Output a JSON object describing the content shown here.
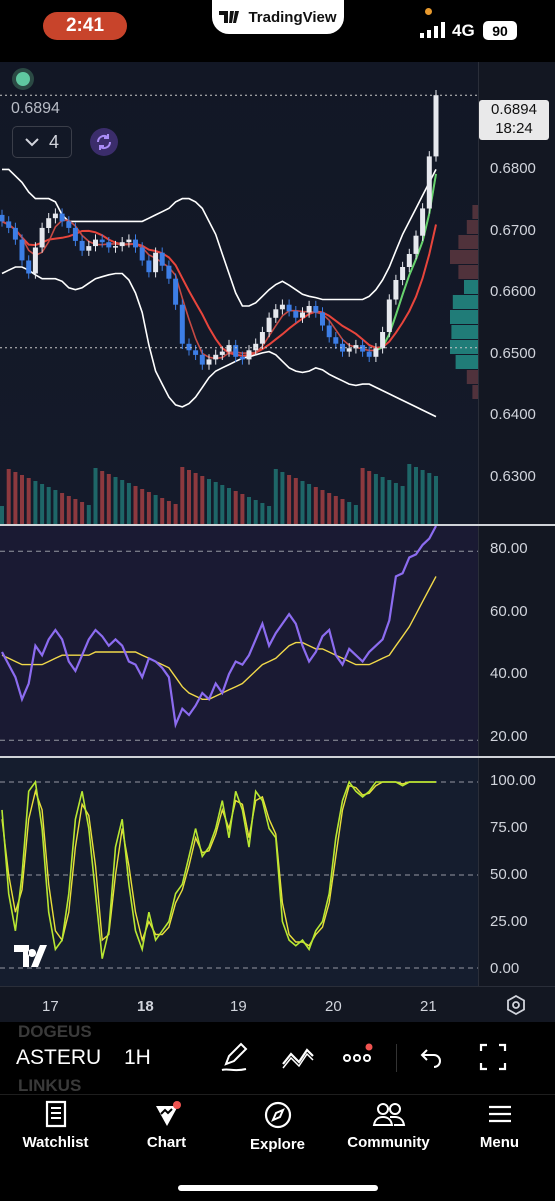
{
  "status_bar": {
    "time": "2:41",
    "app_badge": "TradingView",
    "network": "4G",
    "battery": "90"
  },
  "chart": {
    "last_price_label": "0.6894",
    "price_tag_value": "0.6894",
    "price_tag_countdown": "18:24",
    "collapse_count": "4",
    "price_axis": [
      "0.6800",
      "0.6700",
      "0.6600",
      "0.6500",
      "0.6400",
      "0.6300"
    ],
    "rsi_axis": [
      "80.00",
      "60.00",
      "40.00",
      "20.00"
    ],
    "stoch_axis": [
      "100.00",
      "75.00",
      "50.00",
      "25.00",
      "0.00"
    ],
    "time_axis": [
      "17",
      "18",
      "19",
      "20",
      "21"
    ]
  },
  "chart_data": [
    {
      "type": "candlestick",
      "title": "",
      "ylim": [
        0.6235,
        0.6945
      ],
      "close": [
        0.67,
        0.669,
        0.6672,
        0.664,
        0.662,
        0.666,
        0.669,
        0.6705,
        0.6712,
        0.67,
        0.669,
        0.667,
        0.6655,
        0.6662,
        0.6672,
        0.6668,
        0.666,
        0.6662,
        0.6668,
        0.6672,
        0.666,
        0.664,
        0.6622,
        0.6652,
        0.6632,
        0.6612,
        0.6572,
        0.6512,
        0.6502,
        0.6495,
        0.648,
        0.6488,
        0.6495,
        0.65,
        0.651,
        0.6492,
        0.6488,
        0.6502,
        0.6512,
        0.653,
        0.6552,
        0.6565,
        0.6572,
        0.6562,
        0.6552,
        0.656,
        0.657,
        0.656,
        0.654,
        0.6522,
        0.6512,
        0.65,
        0.6505,
        0.651,
        0.65,
        0.6492,
        0.6505,
        0.653,
        0.658,
        0.661,
        0.663,
        0.665,
        0.6678,
        0.672,
        0.68,
        0.6894
      ],
      "bollinger_upper": [
        0.678,
        0.678,
        0.677,
        0.676,
        0.6745,
        0.6735,
        0.6735,
        0.6735,
        0.673,
        0.671,
        0.67,
        0.67,
        0.67,
        0.67,
        0.67,
        0.67,
        0.67,
        0.67,
        0.67,
        0.67,
        0.67,
        0.67,
        0.6705,
        0.671,
        0.6715,
        0.672,
        0.673,
        0.6735,
        0.6735,
        0.673,
        0.672,
        0.67,
        0.668,
        0.665,
        0.662,
        0.659,
        0.657,
        0.657,
        0.6575,
        0.6585,
        0.6595,
        0.6603,
        0.6608,
        0.6602,
        0.6595,
        0.6588,
        0.6585,
        0.6583,
        0.658,
        0.658,
        0.658,
        0.658,
        0.658,
        0.658,
        0.658,
        0.6585,
        0.6595,
        0.661,
        0.663,
        0.6655,
        0.668,
        0.67,
        0.672,
        0.674,
        0.676,
        0.678
      ],
      "bollinger_lower": [
        0.662,
        0.6625,
        0.663,
        0.663,
        0.6625,
        0.6618,
        0.6612,
        0.6612,
        0.6612,
        0.6608,
        0.6598,
        0.6595,
        0.6598,
        0.6605,
        0.6612,
        0.6615,
        0.6618,
        0.662,
        0.662,
        0.661,
        0.659,
        0.656,
        0.651,
        0.647,
        0.645,
        0.643,
        0.6418,
        0.6415,
        0.642,
        0.643,
        0.6445,
        0.646,
        0.647,
        0.6475,
        0.648,
        0.6485,
        0.649,
        0.6492,
        0.6495,
        0.6498,
        0.65,
        0.6495,
        0.6485,
        0.6475,
        0.647,
        0.6468,
        0.647,
        0.6475,
        0.6472,
        0.6465,
        0.646,
        0.6455,
        0.645,
        0.6448,
        0.645,
        0.645,
        0.6445,
        0.644,
        0.6435,
        0.643,
        0.6425,
        0.642,
        0.6415,
        0.641,
        0.6405,
        0.64
      ]
    },
    {
      "type": "line",
      "title": "",
      "ylim": [
        15,
        88
      ],
      "grid_levels": [
        80,
        20
      ],
      "series": [
        {
          "values": [
            48,
            44,
            40,
            33,
            38,
            50,
            47,
            52,
            55,
            52,
            45,
            42,
            47,
            52,
            55,
            53,
            50,
            52,
            50,
            45,
            44,
            40,
            46,
            45,
            43,
            40,
            25,
            30,
            28,
            31,
            35,
            33,
            38,
            35,
            41,
            45,
            44,
            47,
            52,
            57,
            50,
            54,
            57,
            60,
            57,
            50,
            45,
            48,
            53,
            55,
            47,
            44,
            49,
            47,
            45,
            48,
            50,
            52,
            58,
            72,
            73,
            78,
            79,
            82,
            84,
            88
          ]
        },
        {
          "values": [
            47,
            46,
            45,
            44,
            44,
            44,
            44,
            45,
            46,
            47,
            47,
            47,
            47,
            47,
            48,
            48,
            48,
            48,
            48,
            48,
            48,
            47,
            46,
            45,
            44,
            43,
            40,
            37,
            35,
            34,
            33,
            33,
            34,
            35,
            36,
            37,
            38,
            40,
            42,
            44,
            45,
            46,
            48,
            50,
            51,
            51,
            50,
            49,
            49,
            48,
            47,
            46,
            45,
            44,
            44,
            44,
            45,
            46,
            47,
            50,
            53,
            56,
            60,
            64,
            68,
            72
          ]
        }
      ]
    },
    {
      "type": "line",
      "title": "",
      "ylim": [
        0,
        100
      ],
      "grid_levels": [
        100,
        50,
        0
      ],
      "series": [
        {
          "values": [
            85,
            40,
            20,
            50,
            95,
            100,
            75,
            30,
            10,
            15,
            40,
            80,
            95,
            75,
            40,
            5,
            20,
            65,
            80,
            45,
            20,
            10,
            30,
            15,
            20,
            25,
            40,
            45,
            60,
            75,
            60,
            65,
            75,
            90,
            70,
            95,
            85,
            65,
            95,
            90,
            75,
            70,
            25,
            15,
            12,
            15,
            10,
            20,
            25,
            40,
            70,
            90,
            100,
            95,
            92,
            95,
            100,
            100,
            100,
            100,
            98,
            100,
            100,
            100,
            100,
            100
          ]
        },
        {
          "values": [
            80,
            50,
            30,
            42,
            80,
            95,
            85,
            45,
            20,
            15,
            30,
            65,
            88,
            82,
            55,
            15,
            18,
            50,
            75,
            55,
            30,
            15,
            25,
            18,
            18,
            22,
            35,
            42,
            55,
            70,
            62,
            63,
            72,
            85,
            75,
            90,
            88,
            70,
            90,
            92,
            80,
            72,
            35,
            18,
            14,
            14,
            12,
            18,
            22,
            35,
            60,
            85,
            98,
            97,
            93,
            94,
            98,
            100,
            100,
            100,
            99,
            100,
            100,
            100,
            100,
            100
          ]
        }
      ]
    }
  ],
  "toolbar": {
    "ghost_top": "DOGEUS",
    "symbol": "ASTERU",
    "ghost_bottom": "LINKUS",
    "interval": "1H"
  },
  "nav": [
    {
      "label": "Watchlist"
    },
    {
      "label": "Chart"
    },
    {
      "label": "Explore"
    },
    {
      "label": "Community"
    },
    {
      "label": "Menu"
    }
  ],
  "colors": {
    "up": "#26a69a",
    "down": "#ef5350",
    "rsi": "#8c6cf0",
    "rsi_ma": "#f1d94a",
    "stoch_k": "#b8e832",
    "stoch_d": "#eadf3a",
    "accent": "#2962ff"
  }
}
